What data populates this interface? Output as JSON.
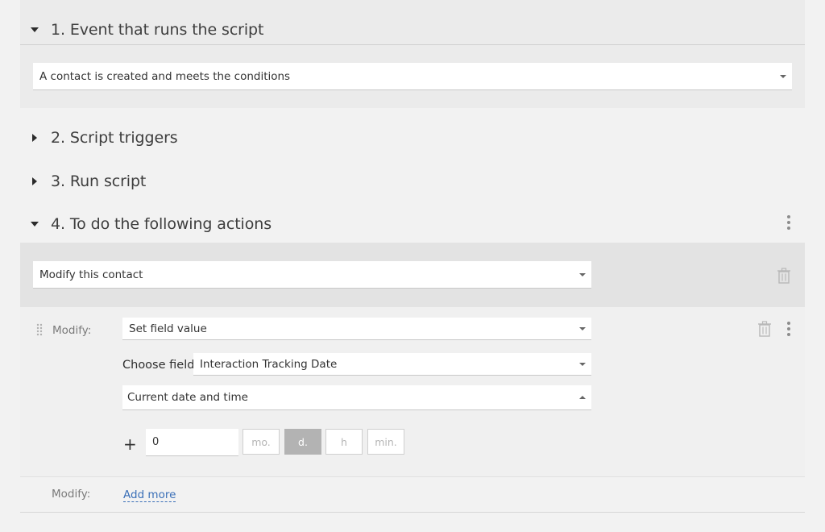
{
  "sections": [
    {
      "number_title": "1. Event that runs the script",
      "expanded": true
    },
    {
      "number_title": "2. Script triggers",
      "expanded": false
    },
    {
      "number_title": "3. Run script",
      "expanded": false
    },
    {
      "number_title": "4. To do the following actions",
      "expanded": true
    }
  ],
  "event": {
    "selected": "A contact is created and meets the conditions"
  },
  "action": {
    "selected": "Modify this contact"
  },
  "modify": {
    "label": "Modify:",
    "operation": "Set field value",
    "choose_field_label": "Choose field:",
    "field": "Interaction Tracking Date",
    "value_source": "Current date and time",
    "offset": {
      "plus_sign": "+",
      "amount": "0",
      "units": [
        "mo.",
        "d.",
        "h",
        "min."
      ],
      "active_unit": "d."
    }
  },
  "footer": {
    "label": "Modify:",
    "add_more": "Add more"
  },
  "icons": {
    "expanded": "triangle-down",
    "collapsed": "triangle-right",
    "delete": "trash-icon",
    "menu": "kebab-icon",
    "drag": "drag-handle-icon"
  },
  "colors": {
    "link": "#3a6fb7",
    "panel": "#e6e6e6",
    "active_unit": "#b3b3b3"
  }
}
